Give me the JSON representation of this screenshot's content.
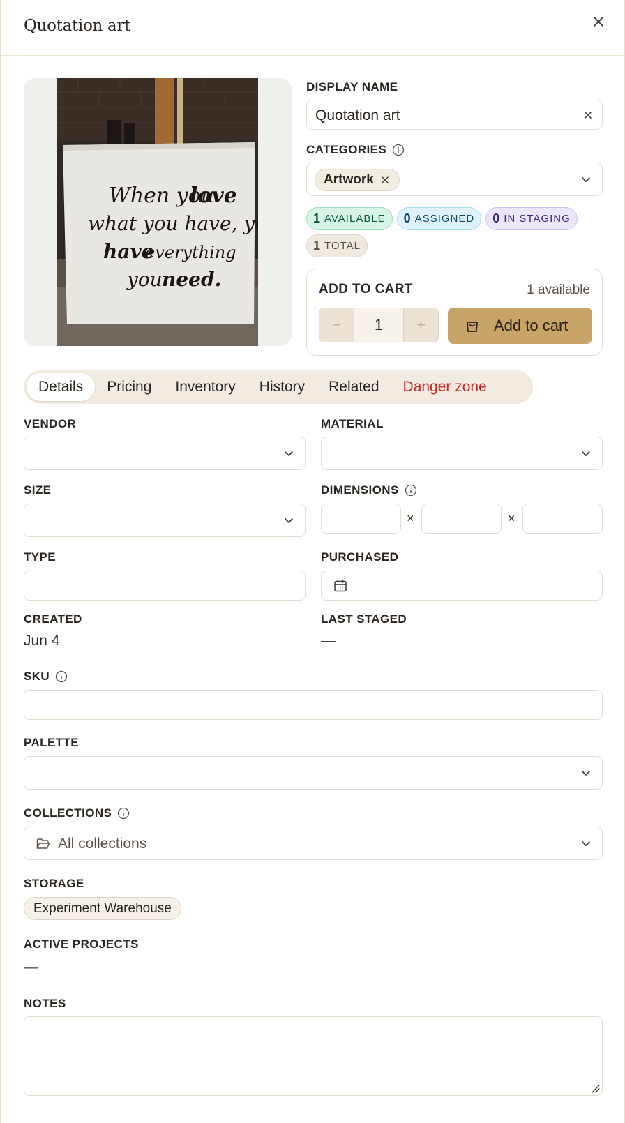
{
  "header": {
    "title": "Quotation art"
  },
  "image": {
    "alt": "When you love what you have, you have everything you need.",
    "lines": [
      "When you love",
      "what you have, you",
      "have everything",
      "you need."
    ]
  },
  "display_name": {
    "label": "DISPLAY NAME",
    "value": "Quotation art"
  },
  "categories": {
    "label": "CATEGORIES",
    "chips": [
      "Artwork"
    ]
  },
  "badges": [
    {
      "count": "1",
      "label": "AVAILABLE"
    },
    {
      "count": "0",
      "label": "ASSIGNED"
    },
    {
      "count": "0",
      "label": "IN STAGING"
    },
    {
      "count": "1",
      "label": "TOTAL"
    }
  ],
  "cart": {
    "title": "ADD TO CART",
    "available_text": "1 available",
    "quantity": "1",
    "button_label": "Add to cart"
  },
  "tabs": [
    {
      "label": "Details",
      "active": true
    },
    {
      "label": "Pricing"
    },
    {
      "label": "Inventory"
    },
    {
      "label": "History"
    },
    {
      "label": "Related"
    },
    {
      "label": "Danger zone",
      "danger": true
    }
  ],
  "fields": {
    "vendor": {
      "label": "VENDOR",
      "value": ""
    },
    "material": {
      "label": "MATERIAL",
      "value": ""
    },
    "size": {
      "label": "SIZE",
      "value": ""
    },
    "dimensions": {
      "label": "DIMENSIONS",
      "separator": "×",
      "values": [
        "",
        "",
        ""
      ]
    },
    "type": {
      "label": "TYPE",
      "value": ""
    },
    "purchased": {
      "label": "PURCHASED",
      "value": ""
    },
    "created": {
      "label": "CREATED",
      "value": "Jun 4"
    },
    "last_staged": {
      "label": "LAST STAGED",
      "value": "—"
    },
    "sku": {
      "label": "SKU",
      "value": ""
    },
    "palette": {
      "label": "PALETTE",
      "value": ""
    },
    "collections": {
      "label": "COLLECTIONS",
      "value": "All collections"
    },
    "storage": {
      "label": "STORAGE",
      "chips": [
        "Experiment Warehouse"
      ]
    },
    "active_projects": {
      "label": "ACTIVE PROJECTS",
      "value": "—"
    },
    "notes": {
      "label": "NOTES",
      "value": ""
    }
  },
  "colors": {
    "accent": "#c8a468",
    "danger": "#c62828",
    "border": "#e4ddd2"
  }
}
